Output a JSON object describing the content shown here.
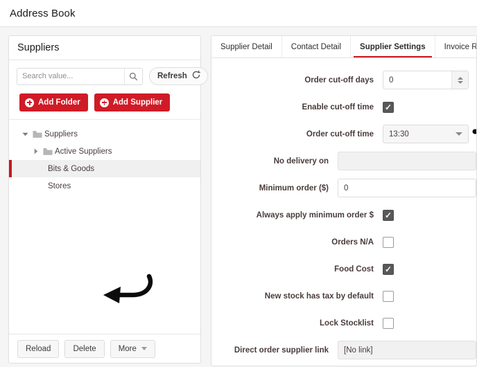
{
  "topbar": {
    "title": "Address Book"
  },
  "left_panel": {
    "header": "Suppliers",
    "search": {
      "placeholder": "Search value...",
      "value": "",
      "icon": "search-icon"
    },
    "refresh": {
      "label": "Refresh",
      "icon": "refresh-icon"
    },
    "actions": [
      {
        "label": "Add Folder",
        "icon": "plus-circle-icon"
      },
      {
        "label": "Add Supplier",
        "icon": "plus-circle-icon"
      }
    ],
    "tree": [
      {
        "label": "Suppliers",
        "level": 1,
        "expanded": true,
        "has_folder": true,
        "selected": false
      },
      {
        "label": "Active Suppliers",
        "level": 2,
        "expanded": false,
        "has_folder": true,
        "selected": false
      },
      {
        "label": "Bits & Goods",
        "level": 3,
        "expanded": null,
        "has_folder": false,
        "selected": true
      },
      {
        "label": "Stores",
        "level": 3,
        "expanded": null,
        "has_folder": false,
        "selected": false
      }
    ],
    "footer": [
      {
        "label": "Reload",
        "dropdown": false
      },
      {
        "label": "Delete",
        "dropdown": false
      },
      {
        "label": "More",
        "dropdown": true
      }
    ]
  },
  "right_panel": {
    "tabs": [
      {
        "label": "Supplier Detail",
        "active": false
      },
      {
        "label": "Contact Detail",
        "active": false
      },
      {
        "label": "Supplier Settings",
        "active": true
      },
      {
        "label": "Invoice Ripper Settings",
        "active": false
      }
    ],
    "fields": [
      {
        "label": "Order cut-off days",
        "type": "spinner",
        "value": "0"
      },
      {
        "label": "Enable cut-off time",
        "type": "checkbox",
        "checked": true
      },
      {
        "label": "Order cut-off time",
        "type": "select",
        "value": "13:30"
      },
      {
        "label": "No delivery on",
        "type": "text-readonly",
        "value": ""
      },
      {
        "label": "Minimum order ($)",
        "type": "text",
        "value": "0"
      },
      {
        "label": "Always apply minimum order $",
        "type": "checkbox",
        "checked": true
      },
      {
        "label": "Orders N/A",
        "type": "checkbox",
        "checked": false
      },
      {
        "label": "Food Cost",
        "type": "checkbox",
        "checked": true
      },
      {
        "label": "New stock has tax by default",
        "type": "checkbox",
        "checked": false
      },
      {
        "label": "Lock Stocklist",
        "type": "checkbox",
        "checked": false
      },
      {
        "label": "Direct order supplier link",
        "type": "link",
        "value": "[No link]"
      }
    ]
  },
  "annotations": [
    {
      "name": "arrow-to-supplier-settings-tab",
      "shape": "curled-arrow-up"
    },
    {
      "name": "arrow-to-bits-and-goods",
      "shape": "hooked-arrow-left"
    }
  ],
  "colors": {
    "brand_red": "#d01b26",
    "accent_red": "#c8171f",
    "page_bg": "#f5f5f5",
    "checkbox_on": "#585858"
  }
}
